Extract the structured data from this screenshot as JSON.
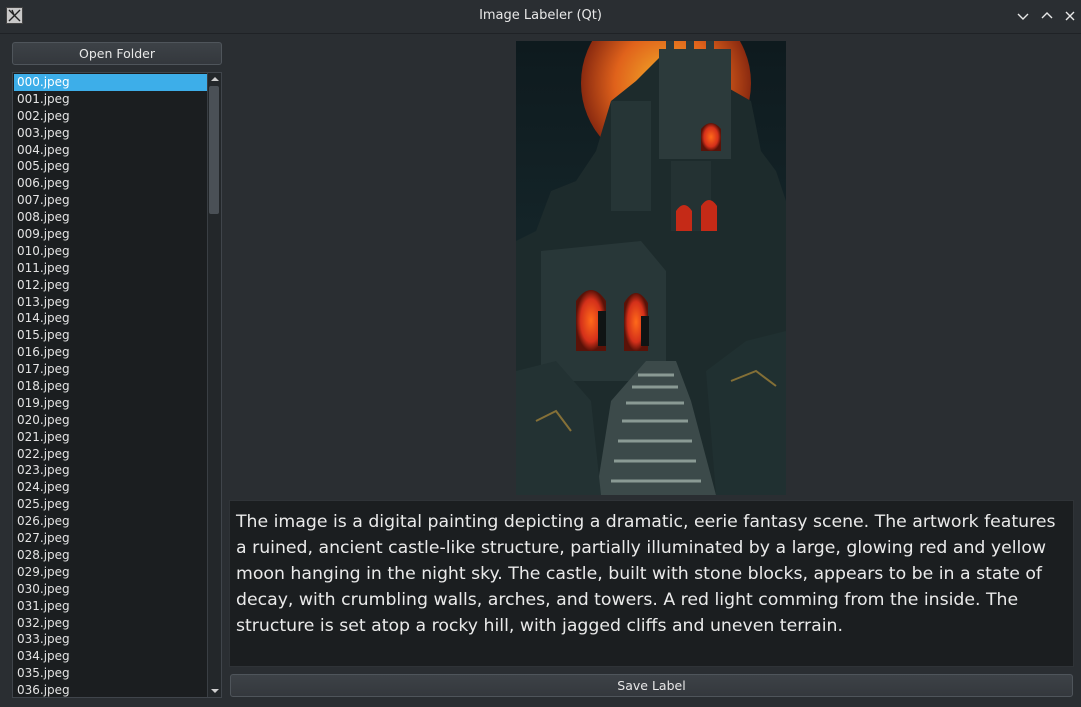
{
  "window": {
    "title": "Image Labeler (Qt)"
  },
  "toolbar": {
    "open_folder_label": "Open Folder",
    "save_label": "Save Label"
  },
  "files": [
    "000.jpeg",
    "001.jpeg",
    "002.jpeg",
    "003.jpeg",
    "004.jpeg",
    "005.jpeg",
    "006.jpeg",
    "007.jpeg",
    "008.jpeg",
    "009.jpeg",
    "010.jpeg",
    "011.jpeg",
    "012.jpeg",
    "013.jpeg",
    "014.jpeg",
    "015.jpeg",
    "016.jpeg",
    "017.jpeg",
    "018.jpeg",
    "019.jpeg",
    "020.jpeg",
    "021.jpeg",
    "022.jpeg",
    "023.jpeg",
    "024.jpeg",
    "025.jpeg",
    "026.jpeg",
    "027.jpeg",
    "028.jpeg",
    "029.jpeg",
    "030.jpeg",
    "031.jpeg",
    "032.jpeg",
    "033.jpeg",
    "034.jpeg",
    "035.jpeg",
    "036.jpeg"
  ],
  "selected_index": 0,
  "label": {
    "text": "The image is a digital painting depicting a dramatic, eerie fantasy scene. The artwork features a ruined, ancient castle-like structure, partially illuminated by a large, glowing red and yellow moon hanging in the night sky. The castle, built with stone blocks, appears to be in a state of decay, with crumbling walls, arches, and towers. A red light comming from the inside. The structure is set atop a rocky hill, with jagged cliffs and uneven terrain."
  },
  "colors": {
    "selection": "#3daee9",
    "background": "#2a2e32",
    "list_background": "#1b1e20"
  }
}
